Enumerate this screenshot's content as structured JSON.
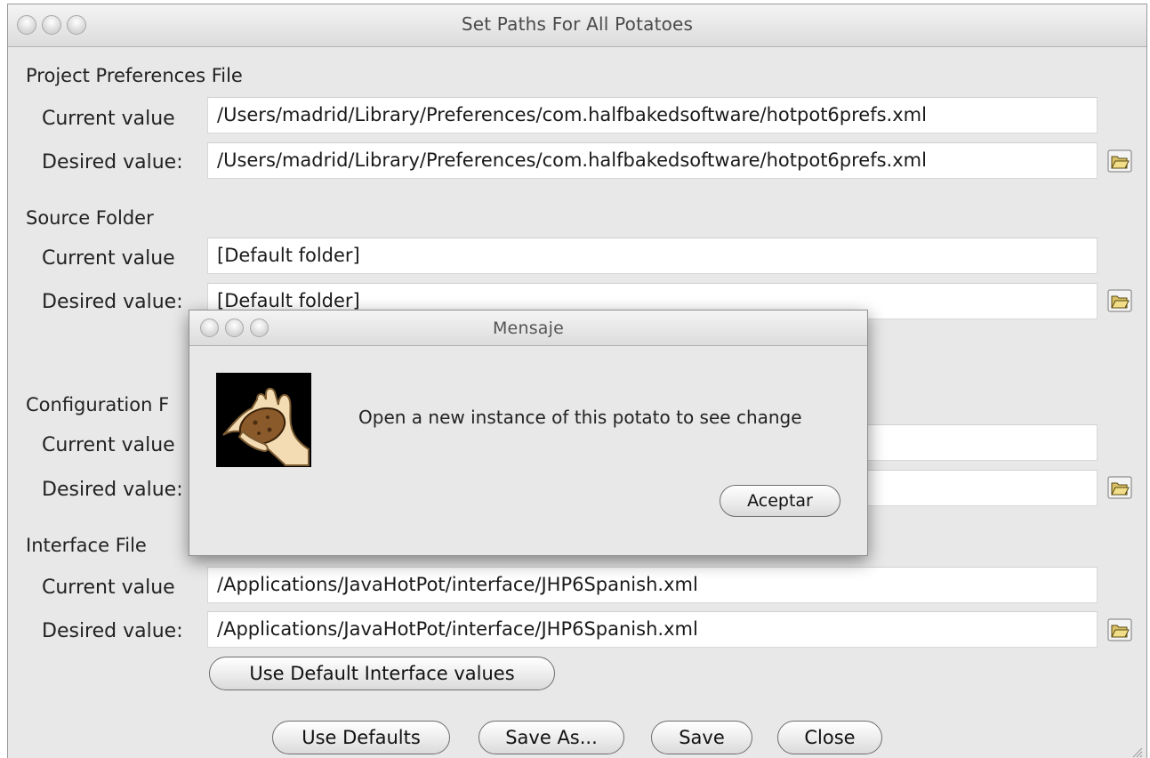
{
  "window": {
    "title": "Set Paths For All Potatoes"
  },
  "sections": [
    {
      "title": "Project Preferences File",
      "current_label": "Current value",
      "current_value": "/Users/madrid/Library/Preferences/com.halfbakedsoftware/hotpot6prefs.xml",
      "desired_label": "Desired value:",
      "desired_value": "/Users/madrid/Library/Preferences/com.halfbakedsoftware/hotpot6prefs.xml"
    },
    {
      "title": "Source Folder",
      "current_label": "Current value",
      "current_value": "[Default folder]",
      "desired_label": "Desired value:",
      "desired_value": "[Default folder]"
    },
    {
      "title": "Configuration F",
      "current_label": "Current value",
      "current_value": "",
      "desired_label": "Desired value:",
      "desired_value": ""
    },
    {
      "title": "Interface File",
      "current_label": "Current value",
      "current_value": "/Applications/JavaHotPot/interface/JHP6Spanish.xml",
      "desired_label": "Desired value:",
      "desired_value": "/Applications/JavaHotPot/interface/JHP6Spanish.xml"
    }
  ],
  "buttons": {
    "use_default_interface": "Use Default Interface values",
    "use_defaults": "Use Defaults",
    "save_as": "Save As...",
    "save": "Save",
    "close": "Close"
  },
  "dialog": {
    "title": "Mensaje",
    "message": "Open a new instance of this potato to see change",
    "ok_label": "Aceptar",
    "icon": "potato-in-hand-icon"
  },
  "icons": {
    "folder_button": "open-folder-icon"
  },
  "colors": {
    "window_bg": "#e8e8e8",
    "field_bg": "#ffffff",
    "title_text": "#4a4a4a"
  }
}
